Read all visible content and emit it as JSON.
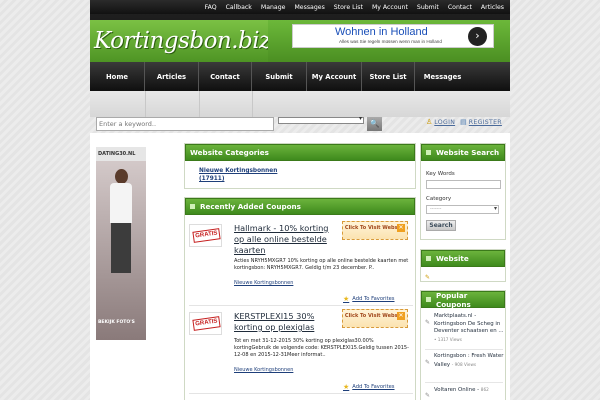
{
  "topbar": {
    "links": [
      "FAQ",
      "Callback",
      "Manage",
      "Messages",
      "Store List",
      "My Account",
      "Submit",
      "Contact",
      "Articles"
    ]
  },
  "header": {
    "logo": "Kortingsbon.biz"
  },
  "ad_banner": {
    "title": "Wohnen in Holland",
    "subtitle": "Alles was Sie regeln müssen wenn man in Holland",
    "arrow": "›"
  },
  "nav": {
    "items": [
      "Home",
      "Articles",
      "Contact",
      "Submit",
      "My Account",
      "Store List",
      "Messages"
    ]
  },
  "search": {
    "placeholder": "Enter a keyword..",
    "go_icon": "🔍"
  },
  "auth": {
    "login": "LOGIN",
    "register": "REGISTER"
  },
  "left_ad": {
    "brand": "DATING30.NL",
    "cta": "BEKIJK FOTO'S"
  },
  "categories": {
    "title": "Website Categories",
    "items": [
      {
        "name": "Nieuwe Kortingsbonnen",
        "count": "(17911)"
      }
    ]
  },
  "coupons": {
    "title": "Recently Added Coupons",
    "stamp": "GRATIS",
    "visit_label": "Click To Visit Website",
    "fav_label": "Add To Favorites",
    "items": [
      {
        "title": "Hallmark - 10% korting op alle online bestelde kaarten",
        "desc": "Acties NRYH5MXGR7 10% korting op alle online bestelde kaarten met kortingsbon: NRYH5MXGR7. Geldig t/m 23 december. P..",
        "category": "Nieuwe Kortingsbonnen"
      },
      {
        "title": "KERSTPLEXI15 30% korting op plexiglas",
        "desc": "Tot en met 31-12-2015 30% korting op plexiglas30.00% kortingGebruik de volgende code: KERSTPLEXI15.Geldig tussen 2015-12-08 en 2015-12-31Meer informat..",
        "category": "Nieuwe Kortingsbonnen"
      }
    ]
  },
  "side_search": {
    "title": "Website Search",
    "keywords_label": "Key Words",
    "category_label": "Category",
    "category_value": "-------",
    "button": "Search"
  },
  "side_website": {
    "title": "Website"
  },
  "popular": {
    "title": "Popular Coupons",
    "items": [
      {
        "name": "Marktplaats.nl - Kortingsbon De Scheg in Deventer schaatsen en ...",
        "views": "• 1317 Views"
      },
      {
        "name": "Kortingsbon : Fresh Water Valley",
        "views": "- 908 Views"
      },
      {
        "name": "Voltaren Online -",
        "views": "862"
      }
    ]
  }
}
